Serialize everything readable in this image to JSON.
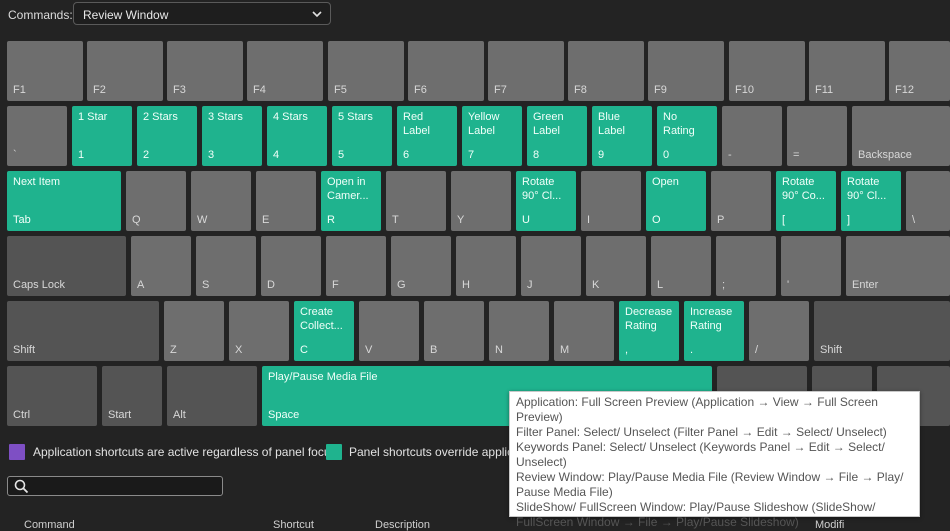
{
  "commands": {
    "label": "Commands:",
    "selected": "Review Window"
  },
  "keys": {
    "f1": {
      "cap": "F1"
    },
    "f2": {
      "cap": "F2"
    },
    "f3": {
      "cap": "F3"
    },
    "f4": {
      "cap": "F4"
    },
    "f5": {
      "cap": "F5"
    },
    "f6": {
      "cap": "F6"
    },
    "f7": {
      "cap": "F7"
    },
    "f8": {
      "cap": "F8"
    },
    "f9": {
      "cap": "F9"
    },
    "f10": {
      "cap": "F10"
    },
    "f11": {
      "cap": "F11"
    },
    "f12": {
      "cap": "F12"
    },
    "backtick": {
      "cap": "`"
    },
    "k1": {
      "cap": "1",
      "cmd": "1 Star"
    },
    "k2": {
      "cap": "2",
      "cmd": "2 Stars"
    },
    "k3": {
      "cap": "3",
      "cmd": "3 Stars"
    },
    "k4": {
      "cap": "4",
      "cmd": "4 Stars"
    },
    "k5": {
      "cap": "5",
      "cmd": "5 Stars"
    },
    "k6": {
      "cap": "6",
      "cmd": "Red\nLabel"
    },
    "k7": {
      "cap": "7",
      "cmd": "Yellow\nLabel"
    },
    "k8": {
      "cap": "8",
      "cmd": "Green\nLabel"
    },
    "k9": {
      "cap": "9",
      "cmd": "Blue\nLabel"
    },
    "k0": {
      "cap": "0",
      "cmd": "No\nRating"
    },
    "minus": {
      "cap": "-"
    },
    "equal": {
      "cap": "="
    },
    "backspace": {
      "cap": "Backspace"
    },
    "tab": {
      "cap": "Tab",
      "cmd": "Next Item"
    },
    "q": {
      "cap": "Q"
    },
    "w": {
      "cap": "W"
    },
    "e": {
      "cap": "E"
    },
    "r": {
      "cap": "R",
      "cmd": "Open in\nCamer..."
    },
    "t": {
      "cap": "T"
    },
    "y": {
      "cap": "Y"
    },
    "u": {
      "cap": "U",
      "cmd": "Rotate\n90° Cl..."
    },
    "i": {
      "cap": "I"
    },
    "o": {
      "cap": "O",
      "cmd": "Open"
    },
    "p": {
      "cap": "P"
    },
    "lbracket": {
      "cap": "[",
      "cmd": "Rotate\n90° Co..."
    },
    "rbracket": {
      "cap": "]",
      "cmd": "Rotate\n90° Cl..."
    },
    "backslash": {
      "cap": "\\"
    },
    "caps": {
      "cap": "Caps Lock"
    },
    "a": {
      "cap": "A"
    },
    "s": {
      "cap": "S"
    },
    "d": {
      "cap": "D"
    },
    "f": {
      "cap": "F"
    },
    "g": {
      "cap": "G"
    },
    "h": {
      "cap": "H"
    },
    "j": {
      "cap": "J"
    },
    "k": {
      "cap": "K"
    },
    "l": {
      "cap": "L"
    },
    "semicolon": {
      "cap": ";"
    },
    "quote": {
      "cap": "'"
    },
    "enter": {
      "cap": "Enter"
    },
    "lshift": {
      "cap": "Shift"
    },
    "z": {
      "cap": "Z"
    },
    "x": {
      "cap": "X"
    },
    "c": {
      "cap": "C",
      "cmd": "Create\nCollect..."
    },
    "v": {
      "cap": "V"
    },
    "b": {
      "cap": "B"
    },
    "n": {
      "cap": "N"
    },
    "m": {
      "cap": "M"
    },
    "comma": {
      "cap": ",",
      "cmd": "Decrease\nRating"
    },
    "period": {
      "cap": ".",
      "cmd": "Increase\nRating"
    },
    "slash": {
      "cap": "/"
    },
    "rshift": {
      "cap": "Shift"
    },
    "ctrl": {
      "cap": "Ctrl"
    },
    "start": {
      "cap": "Start"
    },
    "alt": {
      "cap": "Alt"
    },
    "space": {
      "cap": "Space",
      "cmd": "Play/Pause Media File"
    }
  },
  "legend": {
    "app_color": "#7e4fc4",
    "app_text": "Application shortcuts are active regardless of panel focus",
    "panel_color": "#1fb38e",
    "panel_text": "Panel shortcuts override applica"
  },
  "search": {
    "placeholder": "",
    "value": ""
  },
  "columns": {
    "command": "Command",
    "shortcut": "Shortcut",
    "description": "Description",
    "modifiers": "Modifi"
  },
  "tooltip": [
    "Application: Full Screen Preview (Application → View → Full Screen Preview)",
    "Filter Panel: Select/ Unselect (Filter Panel → Edit → Select/ Unselect)",
    "Keywords Panel: Select/ Unselect (Keywords Panel → Edit → Select/ Unselect)",
    "Review Window: Play/Pause Media File (Review Window → File → Play/ Pause Media File)",
    "SlideShow/ FullScreen Window: Play/Pause Slideshow (SlideShow/ FullScreen Window → File → Play/Pause Slideshow)"
  ],
  "colors": {
    "key": "#6e6e6e",
    "key_dark": "#545454",
    "assigned": "#1fb38e",
    "background": "#232323"
  }
}
